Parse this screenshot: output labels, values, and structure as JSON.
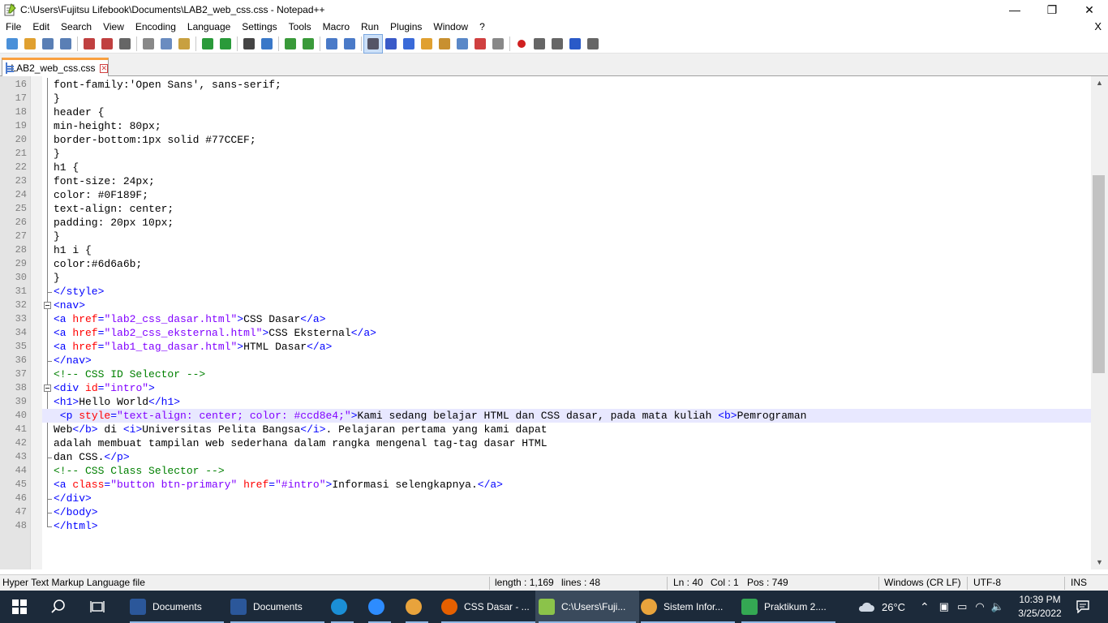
{
  "window": {
    "title": "C:\\Users\\Fujitsu Lifebook\\Documents\\LAB2_web_css.css - Notepad++",
    "minimize": "—",
    "maximize": "❐",
    "close": "✕"
  },
  "menu": {
    "items": [
      "File",
      "Edit",
      "Search",
      "View",
      "Encoding",
      "Language",
      "Settings",
      "Tools",
      "Macro",
      "Run",
      "Plugins",
      "Window",
      "?"
    ],
    "close_doc": "X"
  },
  "toolbar": {
    "icons": [
      "new-file-icon",
      "open-file-icon",
      "save-icon",
      "save-all-icon",
      "close-icon",
      "close-all-icon",
      "print-icon",
      "cut-icon",
      "copy-icon",
      "paste-icon",
      "undo-icon",
      "redo-icon",
      "find-icon",
      "replace-icon",
      "zoom-in-icon",
      "zoom-out-icon",
      "sync-vertical-icon",
      "sync-horizontal-icon",
      "word-wrap-icon",
      "show-all-chars-icon",
      "indent-guide-icon",
      "user-lang-icon",
      "doc-map-icon",
      "function-list-icon",
      "folder-workspace-icon",
      "monitoring-icon",
      "record-macro-icon",
      "stop-record-icon",
      "play-macro-icon",
      "run-macro-multiple-icon",
      "save-macro-icon"
    ]
  },
  "tab": {
    "label": "LAB2_web_css.css",
    "close": "✕"
  },
  "editor": {
    "lines": [
      {
        "n": "16",
        "seg": [
          [
            "c-txt",
            "font-family:'Open Sans', sans-serif;"
          ]
        ]
      },
      {
        "n": "17",
        "seg": [
          [
            "c-txt",
            "}"
          ]
        ]
      },
      {
        "n": "18",
        "seg": [
          [
            "c-txt",
            "header {"
          ]
        ]
      },
      {
        "n": "19",
        "seg": [
          [
            "c-txt",
            "min-height: 80px;"
          ]
        ]
      },
      {
        "n": "20",
        "seg": [
          [
            "c-txt",
            "border-bottom:1px solid #77CCEF;"
          ]
        ]
      },
      {
        "n": "21",
        "seg": [
          [
            "c-txt",
            "}"
          ]
        ]
      },
      {
        "n": "22",
        "seg": [
          [
            "c-txt",
            "h1 {"
          ]
        ]
      },
      {
        "n": "23",
        "seg": [
          [
            "c-txt",
            "font-size: 24px;"
          ]
        ]
      },
      {
        "n": "24",
        "seg": [
          [
            "c-txt",
            "color: #0F189F;"
          ]
        ]
      },
      {
        "n": "25",
        "seg": [
          [
            "c-txt",
            "text-align: center;"
          ]
        ]
      },
      {
        "n": "26",
        "seg": [
          [
            "c-txt",
            "padding: 20px 10px;"
          ]
        ]
      },
      {
        "n": "27",
        "seg": [
          [
            "c-txt",
            "}"
          ]
        ]
      },
      {
        "n": "28",
        "seg": [
          [
            "c-txt",
            "h1 i {"
          ]
        ]
      },
      {
        "n": "29",
        "seg": [
          [
            "c-txt",
            "color:#6d6a6b;"
          ]
        ]
      },
      {
        "n": "30",
        "seg": [
          [
            "c-txt",
            "}"
          ]
        ]
      },
      {
        "n": "31",
        "seg": [
          [
            "c-tag",
            "</style>"
          ]
        ]
      },
      {
        "n": "32",
        "seg": [
          [
            "c-tag",
            "<nav>"
          ]
        ]
      },
      {
        "n": "33",
        "seg": [
          [
            "c-tag",
            "<a "
          ],
          [
            "c-attr",
            "href"
          ],
          [
            "c-tag",
            "="
          ],
          [
            "c-val",
            "\"lab2_css_dasar.html\""
          ],
          [
            "c-tag",
            ">"
          ],
          [
            "c-txt",
            "CSS Dasar"
          ],
          [
            "c-tag",
            "</a>"
          ]
        ]
      },
      {
        "n": "34",
        "seg": [
          [
            "c-tag",
            "<a "
          ],
          [
            "c-attr",
            "href"
          ],
          [
            "c-tag",
            "="
          ],
          [
            "c-val",
            "\"lab2_css_eksternal.html\""
          ],
          [
            "c-tag",
            ">"
          ],
          [
            "c-txt",
            "CSS Eksternal"
          ],
          [
            "c-tag",
            "</a>"
          ]
        ]
      },
      {
        "n": "35",
        "seg": [
          [
            "c-tag",
            "<a "
          ],
          [
            "c-attr",
            "href"
          ],
          [
            "c-tag",
            "="
          ],
          [
            "c-val",
            "\"lab1_tag_dasar.html\""
          ],
          [
            "c-tag",
            ">"
          ],
          [
            "c-txt",
            "HTML Dasar"
          ],
          [
            "c-tag",
            "</a>"
          ]
        ]
      },
      {
        "n": "36",
        "seg": [
          [
            "c-tag",
            "</nav>"
          ]
        ]
      },
      {
        "n": "37",
        "seg": [
          [
            "c-com",
            "<!-- CSS ID Selector -->"
          ]
        ]
      },
      {
        "n": "38",
        "seg": [
          [
            "c-tag",
            "<div "
          ],
          [
            "c-attr",
            "id"
          ],
          [
            "c-tag",
            "="
          ],
          [
            "c-val",
            "\"intro\""
          ],
          [
            "c-tag",
            ">"
          ]
        ]
      },
      {
        "n": "39",
        "seg": [
          [
            "c-tag",
            "<h1>"
          ],
          [
            "c-txt",
            "Hello World"
          ],
          [
            "c-tag",
            "</h1>"
          ]
        ]
      },
      {
        "n": "40",
        "seg": [
          [
            "c-tag",
            " <p "
          ],
          [
            "c-attr",
            "style"
          ],
          [
            "c-tag",
            "="
          ],
          [
            "c-val",
            "\"text-align: center; color: #ccd8e4;\""
          ],
          [
            "c-tag",
            ">"
          ],
          [
            "c-txt",
            "Kami sedang belajar HTML dan CSS dasar, pada mata kuliah "
          ],
          [
            "c-tag",
            "<b>"
          ],
          [
            "c-txt",
            "Pemrograman"
          ]
        ]
      },
      {
        "n": "41",
        "seg": [
          [
            "c-txt",
            "Web"
          ],
          [
            "c-tag",
            "</b>"
          ],
          [
            "c-txt",
            " di "
          ],
          [
            "c-tag",
            "<i>"
          ],
          [
            "c-txt",
            "Universitas Pelita Bangsa"
          ],
          [
            "c-tag",
            "</i>"
          ],
          [
            "c-txt",
            ". Pelajaran pertama yang kami dapat"
          ]
        ]
      },
      {
        "n": "42",
        "seg": [
          [
            "c-txt",
            "adalah membuat tampilan web sederhana dalam rangka mengenal tag-tag dasar HTML"
          ]
        ]
      },
      {
        "n": "43",
        "seg": [
          [
            "c-txt",
            "dan CSS."
          ],
          [
            "c-tag",
            "</p>"
          ]
        ]
      },
      {
        "n": "44",
        "seg": [
          [
            "c-com",
            "<!-- CSS Class Selector -->"
          ]
        ]
      },
      {
        "n": "45",
        "seg": [
          [
            "c-tag",
            "<a "
          ],
          [
            "c-attr",
            "class"
          ],
          [
            "c-tag",
            "="
          ],
          [
            "c-val",
            "\"button btn-primary\""
          ],
          [
            "c-tag",
            " "
          ],
          [
            "c-attr",
            "href"
          ],
          [
            "c-tag",
            "="
          ],
          [
            "c-val",
            "\"#intro\""
          ],
          [
            "c-tag",
            ">"
          ],
          [
            "c-txt",
            "Informasi selengkapnya."
          ],
          [
            "c-tag",
            "</a>"
          ]
        ]
      },
      {
        "n": "46",
        "seg": [
          [
            "c-tag",
            "</div>"
          ]
        ]
      },
      {
        "n": "47",
        "seg": [
          [
            "c-tag",
            "</body>"
          ]
        ]
      },
      {
        "n": "48",
        "seg": [
          [
            "c-tag",
            "</html>"
          ]
        ]
      }
    ],
    "current_line": "40"
  },
  "status": {
    "file_type": "Hyper Text Markup Language file",
    "length": "length : 1,169",
    "lines": "lines : 48",
    "ln": "Ln : 40",
    "col": "Col : 1",
    "pos": "Pos : 749",
    "eol": "Windows (CR LF)",
    "encoding": "UTF-8",
    "mode": "INS"
  },
  "taskbar": {
    "apps": [
      {
        "label": "Documents",
        "icon": "word-doc-icon",
        "color": "#2b579a"
      },
      {
        "label": "Documents",
        "icon": "word-doc-icon",
        "color": "#2b579a"
      },
      {
        "label": "",
        "icon": "edge-icon",
        "color": "#1b8fd6"
      },
      {
        "label": "",
        "icon": "zoom-icon",
        "color": "#2d8cff"
      },
      {
        "label": "",
        "icon": "chrome-icon",
        "color": "#e8a33c"
      },
      {
        "label": "CSS Dasar - ...",
        "icon": "firefox-icon",
        "color": "#e66000"
      },
      {
        "label": "C:\\Users\\Fuji...",
        "icon": "notepadpp-icon",
        "color": "#8bc34a"
      },
      {
        "label": "Sistem Infor...",
        "icon": "chrome-icon",
        "color": "#e8a33c"
      },
      {
        "label": "Praktikum 2....",
        "icon": "drive-icon",
        "color": "#34a853"
      }
    ],
    "weather": "26°C",
    "time": "10:39 PM",
    "date": "3/25/2022"
  }
}
